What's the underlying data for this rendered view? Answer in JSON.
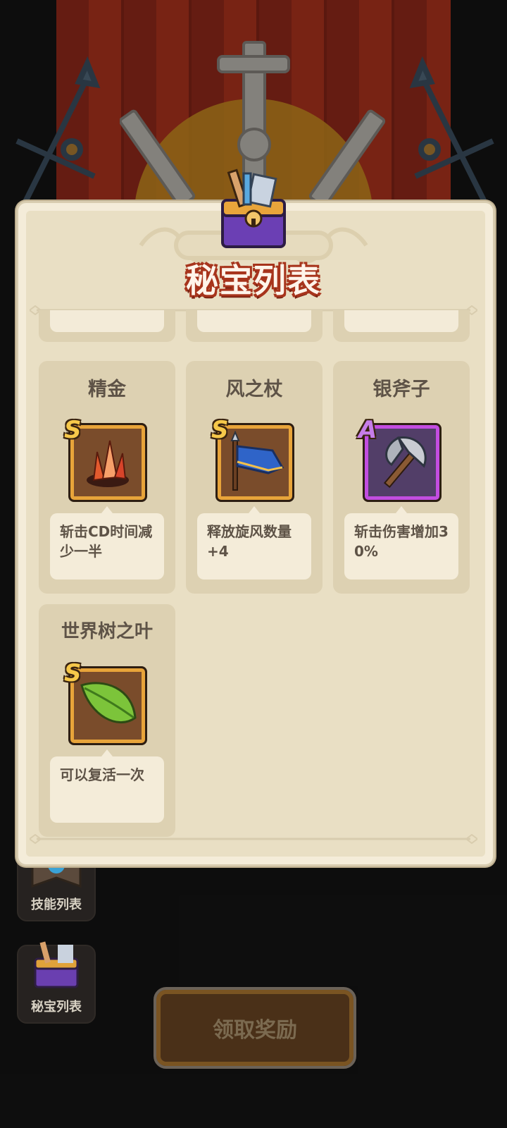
{
  "panel": {
    "title": "秘宝列表",
    "items": [
      {
        "name": "精金",
        "rank": "S",
        "rank_color": "#f6c84a",
        "icon": "crystal-icon",
        "desc": "斩击CD时间减少一半"
      },
      {
        "name": "风之杖",
        "rank": "S",
        "rank_color": "#f6c84a",
        "icon": "wind-flag-staff-icon",
        "desc": "释放旋风数量+4"
      },
      {
        "name": "银斧子",
        "rank": "A",
        "rank_color": "#c67de8",
        "icon": "silver-axe-icon",
        "desc": "斩击伤害增加30%"
      },
      {
        "name": "世界树之叶",
        "rank": "S",
        "rank_color": "#f6c84a",
        "icon": "green-leaf-icon",
        "desc": "可以复活一次"
      }
    ]
  },
  "side_menu": {
    "skills_label": "技能列表",
    "treasure_label": "秘宝列表"
  },
  "claim_button": {
    "label": "领取奖励"
  },
  "colors": {
    "title_outline": "#a7341c",
    "panel_bg": "#f4ecd9",
    "card_bg": "#ddd1b2",
    "text": "#5e5347"
  }
}
